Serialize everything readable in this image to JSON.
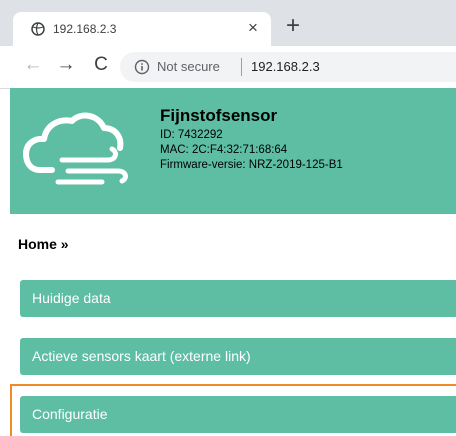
{
  "browser": {
    "tab": {
      "title": "192.168.2.3",
      "close_glyph": "×",
      "favicon": "globe-icon"
    },
    "new_tab_glyph": "+",
    "toolbar": {
      "back_glyph": "←",
      "forward_glyph": "→",
      "reload_glyph": "C"
    },
    "address": {
      "security_text": "Not secure",
      "url": "192.168.2.3"
    }
  },
  "header": {
    "title": "Fijnstofsensor",
    "id": "ID: 7432292",
    "mac": "MAC: 2C:F4:32:71:68:64",
    "firmware": "Firmware-versie: NRZ-2019-125-B1",
    "logo": "cloud-wind-icon"
  },
  "breadcrumb": "Home »",
  "menu": [
    {
      "label": "Huidige data"
    },
    {
      "label": "Actieve sensors kaart (externe link)"
    },
    {
      "label": "Configuratie",
      "focused": true
    }
  ],
  "colors": {
    "accent": "#5dbea3",
    "focus": "#f08a24"
  }
}
